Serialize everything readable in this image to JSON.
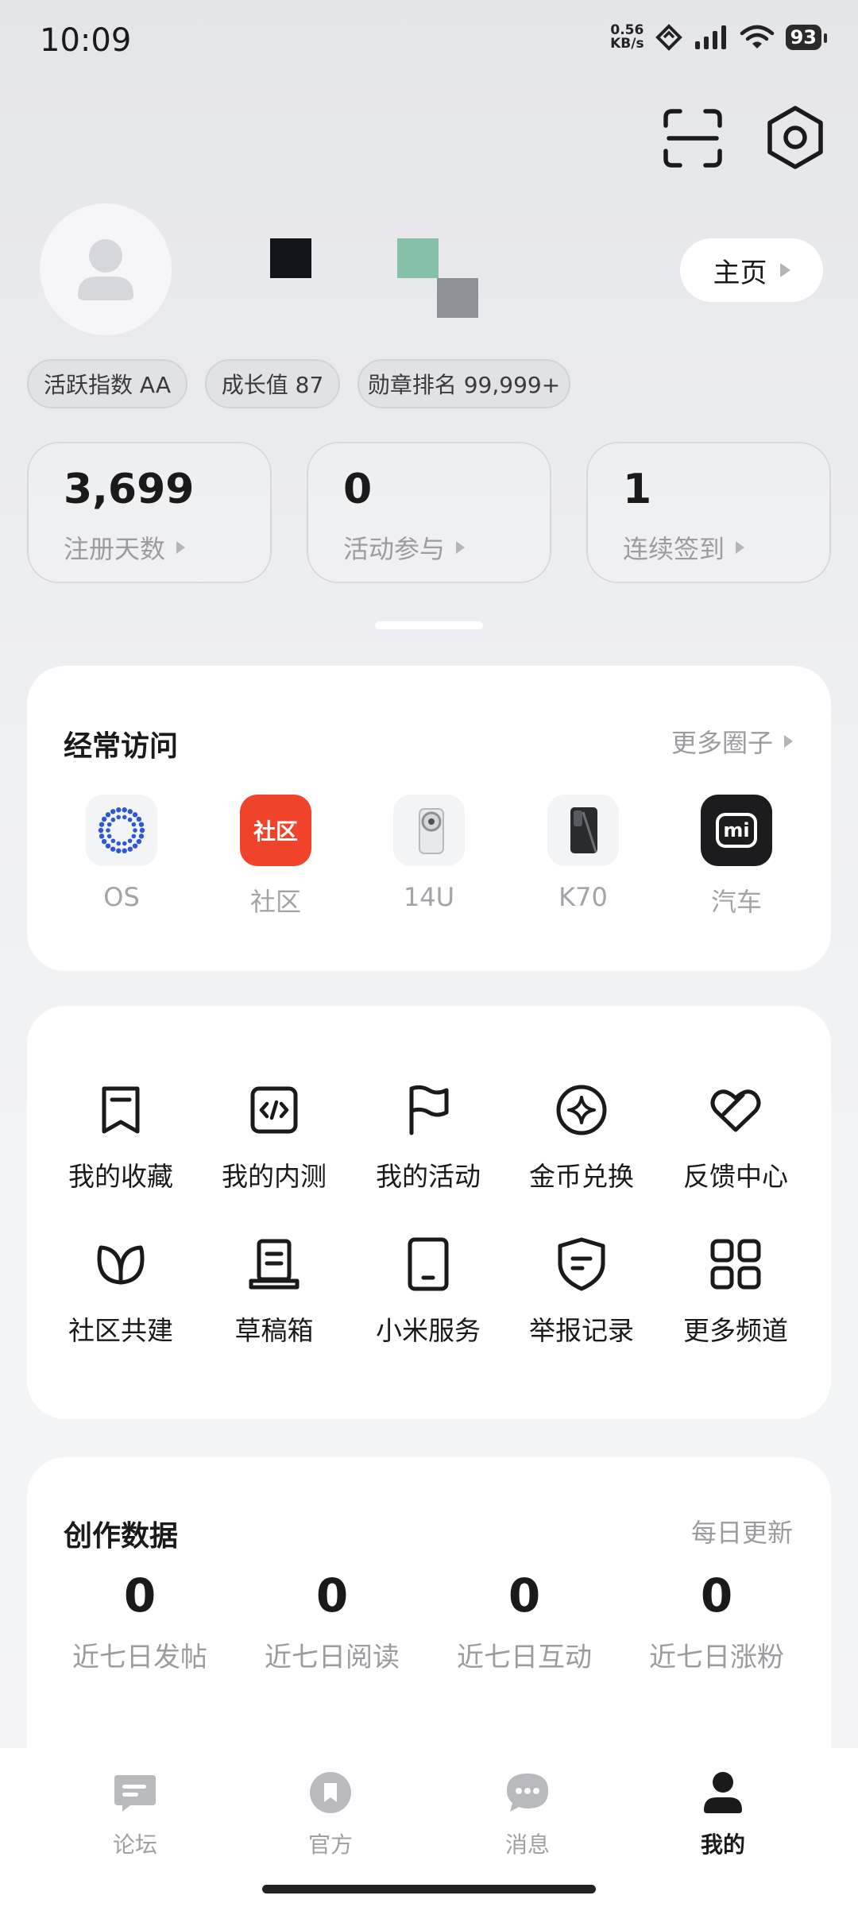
{
  "status_bar": {
    "time": "10:09",
    "net_speed_value": "0.56",
    "net_speed_unit": "KB/s",
    "battery": "93"
  },
  "header": {
    "icons": [
      "scan-icon",
      "settings-icon"
    ]
  },
  "profile": {
    "home_label": "主页",
    "badges": [
      "活跃指数 AA",
      "成长值 87",
      "勋章排名 99,999+"
    ]
  },
  "stats": [
    {
      "value": "3,699",
      "label": "注册天数"
    },
    {
      "value": "0",
      "label": "活动参与"
    },
    {
      "value": "1",
      "label": "连续签到"
    }
  ],
  "frequent": {
    "title": "经常访问",
    "more": "更多圈子",
    "items": [
      {
        "label": "OS",
        "icon": "os-icon"
      },
      {
        "label": "社区",
        "icon": "community-icon",
        "icon_text": "社区"
      },
      {
        "label": "14U",
        "icon": "phone-14u-icon"
      },
      {
        "label": "K70",
        "icon": "phone-k70-icon"
      },
      {
        "label": "汽车",
        "icon": "mi-car-icon",
        "icon_text": "mi"
      }
    ]
  },
  "tools": [
    {
      "label": "我的收藏",
      "icon": "bookmark-icon"
    },
    {
      "label": "我的内测",
      "icon": "code-icon"
    },
    {
      "label": "我的活动",
      "icon": "flag-icon"
    },
    {
      "label": "金币兑换",
      "icon": "coin-icon"
    },
    {
      "label": "反馈中心",
      "icon": "heart-icon"
    },
    {
      "label": "社区共建",
      "icon": "leaf-icon"
    },
    {
      "label": "草稿箱",
      "icon": "drafts-icon"
    },
    {
      "label": "小米服务",
      "icon": "tablet-icon"
    },
    {
      "label": "举报记录",
      "icon": "shield-icon"
    },
    {
      "label": "更多频道",
      "icon": "grid-icon"
    }
  ],
  "creation": {
    "title": "创作数据",
    "note": "每日更新",
    "items": [
      {
        "value": "0",
        "label": "近七日发帖"
      },
      {
        "value": "0",
        "label": "近七日阅读"
      },
      {
        "value": "0",
        "label": "近七日互动"
      },
      {
        "value": "0",
        "label": "近七日涨粉"
      }
    ]
  },
  "nav": [
    {
      "label": "论坛",
      "icon": "forum-icon"
    },
    {
      "label": "官方",
      "icon": "official-icon"
    },
    {
      "label": "消息",
      "icon": "message-icon"
    },
    {
      "label": "我的",
      "icon": "profile-icon",
      "active": true
    }
  ],
  "colors": {
    "accent_red": "#f0432b",
    "text_primary": "#1a1a1a",
    "text_secondary": "#9c9ca0"
  }
}
